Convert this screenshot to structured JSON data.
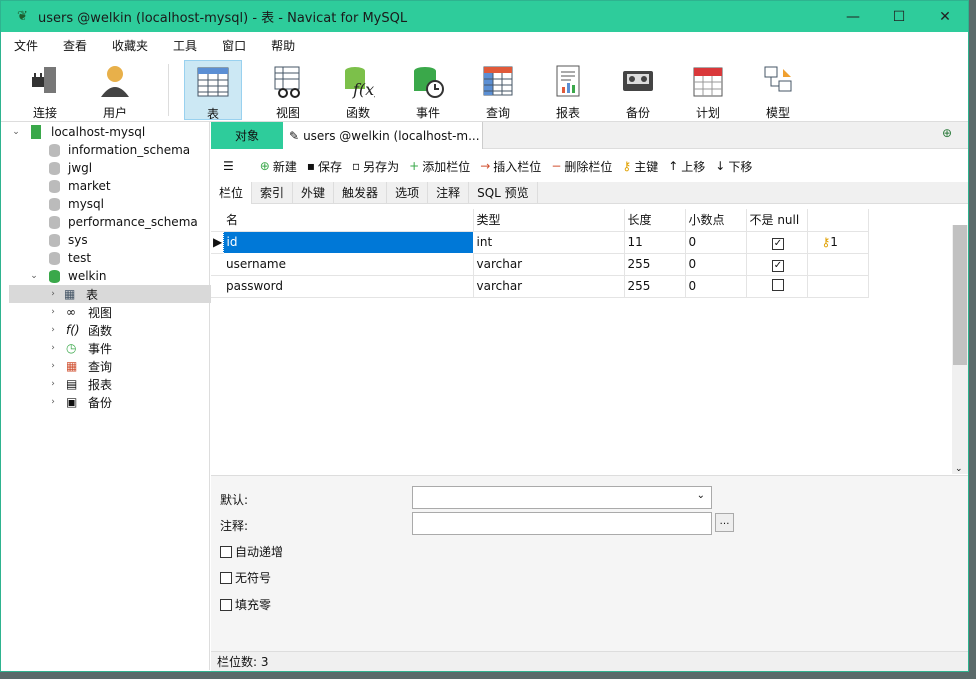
{
  "window": {
    "title": "users @welkin (localhost-mysql) - 表 - Navicat for MySQL"
  },
  "menu": [
    "文件",
    "查看",
    "收藏夹",
    "工具",
    "窗口",
    "帮助"
  ],
  "toolbar": [
    {
      "label": "连接",
      "icon": "plug-icon"
    },
    {
      "label": "用户",
      "icon": "user-icon"
    },
    {
      "label": "表",
      "icon": "table-icon"
    },
    {
      "label": "视图",
      "icon": "view-icon"
    },
    {
      "label": "函数",
      "icon": "function-icon"
    },
    {
      "label": "事件",
      "icon": "event-icon"
    },
    {
      "label": "查询",
      "icon": "query-icon"
    },
    {
      "label": "报表",
      "icon": "report-icon"
    },
    {
      "label": "备份",
      "icon": "backup-icon"
    },
    {
      "label": "计划",
      "icon": "schedule-icon"
    },
    {
      "label": "模型",
      "icon": "model-icon"
    }
  ],
  "tree": {
    "connection": "localhost-mysql",
    "databases": [
      "information_schema",
      "jwgl",
      "market",
      "mysql",
      "performance_schema",
      "sys",
      "test"
    ],
    "open_db": "welkin",
    "children": [
      "表",
      "视图",
      "函数",
      "事件",
      "查询",
      "报表",
      "备份"
    ]
  },
  "tabs": {
    "objects": "对象",
    "doc": "users @welkin (localhost-m..."
  },
  "edit_toolbar": [
    "新建",
    "保存",
    "另存为",
    "添加栏位",
    "插入栏位",
    "删除栏位",
    "主键",
    "上移",
    "下移"
  ],
  "subtabs": [
    "栏位",
    "索引",
    "外键",
    "触发器",
    "选项",
    "注释",
    "SQL 预览"
  ],
  "grid": {
    "headers": [
      "名",
      "类型",
      "长度",
      "小数点",
      "不是 null",
      ""
    ],
    "rows": [
      {
        "name": "id",
        "type": "int",
        "length": "11",
        "decimals": "0",
        "notnull": true,
        "key": "1"
      },
      {
        "name": "username",
        "type": "varchar",
        "length": "255",
        "decimals": "0",
        "notnull": true,
        "key": ""
      },
      {
        "name": "password",
        "type": "varchar",
        "length": "255",
        "decimals": "0",
        "notnull": false,
        "key": ""
      }
    ]
  },
  "props": {
    "default_label": "默认:",
    "comment_label": "注释:",
    "auto_inc": "自动递增",
    "unsigned": "无符号",
    "zerofill": "填充零"
  },
  "status": "栏位数: 3"
}
